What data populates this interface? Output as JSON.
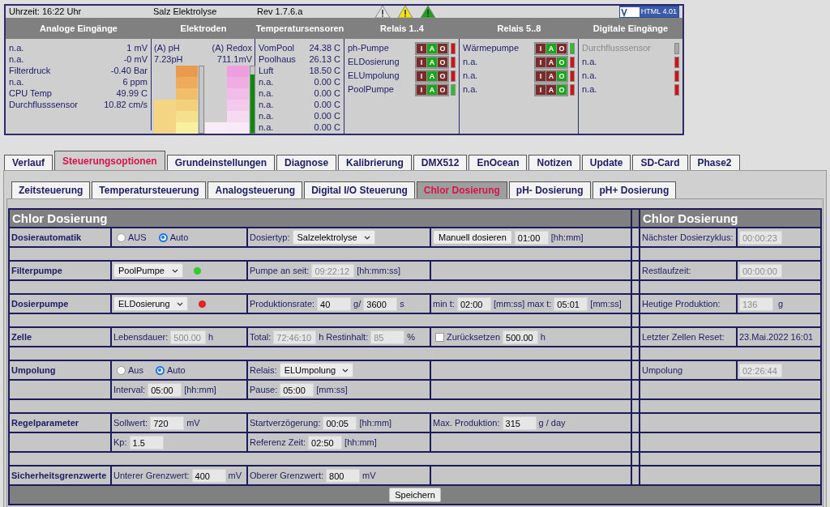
{
  "header": {
    "time": "Uhrzeit: 16:22 Uhr",
    "title": "Salz Elektrolyse",
    "revision": "Rev 1.7.6.a",
    "warnings": [
      {
        "color": "#e4e4e4"
      },
      {
        "color": "#f2e600"
      },
      {
        "color": "#1fa01f"
      }
    ],
    "badge": "HTML 4.01"
  },
  "status_columns": [
    "Analoge Eingänge",
    "Elektroden",
    "Temperatursensoren",
    "Relais 1..4",
    "Relais 5..8",
    "Digitale Eingänge"
  ],
  "analog_inputs": [
    {
      "name": "n.a.",
      "value": "1 mV"
    },
    {
      "name": "n.a.",
      "value": "-0 mV"
    },
    {
      "name": "Filterdruck",
      "value": "-0.40 Bar"
    },
    {
      "name": "n.a.",
      "value": "6 ppm"
    },
    {
      "name": "CPU Temp",
      "value": "49.99 C"
    },
    {
      "name": "Durchflusssensor",
      "value": "10.82 cm/s"
    }
  ],
  "electrodes": [
    {
      "name": "(A) pH",
      "value": "7.23pH"
    },
    {
      "name": "(A) Redox",
      "value": "711.1mV",
      "level": 0.88
    }
  ],
  "temperatures": [
    {
      "name": "VomPool",
      "value": "24.38 C"
    },
    {
      "name": "Poolhaus",
      "value": "26.13 C"
    },
    {
      "name": "Luft",
      "value": "18.50 C"
    },
    {
      "name": "n.a.",
      "value": "0.00 C"
    },
    {
      "name": "n.a.",
      "value": "0.00 C"
    },
    {
      "name": "n.a.",
      "value": "0.00 C"
    },
    {
      "name": "n.a.",
      "value": "0.00 C"
    },
    {
      "name": "n.a.",
      "value": "0.00 C"
    }
  ],
  "relays_1_4": [
    {
      "name": "ph-Pumpe",
      "on": false,
      "modes": [
        {
          "label": "I",
          "selected": false
        },
        {
          "label": "A",
          "selected": true
        },
        {
          "label": "O",
          "selected": false
        }
      ]
    },
    {
      "name": "ELDosierung",
      "on": false,
      "modes": [
        {
          "label": "I",
          "selected": false
        },
        {
          "label": "A",
          "selected": true
        },
        {
          "label": "O",
          "selected": false
        }
      ]
    },
    {
      "name": "ELUmpolung",
      "on": false,
      "modes": [
        {
          "label": "I",
          "selected": false
        },
        {
          "label": "A",
          "selected": true
        },
        {
          "label": "O",
          "selected": false
        }
      ]
    },
    {
      "name": "PoolPumpe",
      "on": true,
      "modes": [
        {
          "label": "I",
          "selected": false
        },
        {
          "label": "A",
          "selected": true
        },
        {
          "label": "O",
          "selected": false
        }
      ]
    }
  ],
  "relays_5_8": [
    {
      "name": "Wärmepumpe",
      "on": true,
      "modes": [
        {
          "label": "I",
          "selected": false
        },
        {
          "label": "A",
          "selected": true
        },
        {
          "label": "O",
          "selected": false
        }
      ]
    },
    {
      "name": "n.a.",
      "on": false,
      "modes": [
        {
          "label": "I",
          "selected": false
        },
        {
          "label": "A",
          "selected": false
        },
        {
          "label": "O",
          "selected": true
        }
      ]
    },
    {
      "name": "n.a.",
      "on": false,
      "modes": [
        {
          "label": "I",
          "selected": false
        },
        {
          "label": "A",
          "selected": false
        },
        {
          "label": "O",
          "selected": true
        }
      ]
    },
    {
      "name": "n.a.",
      "on": false,
      "modes": [
        {
          "label": "I",
          "selected": false
        },
        {
          "label": "A",
          "selected": false
        },
        {
          "label": "O",
          "selected": true
        }
      ]
    }
  ],
  "digital_inputs": [
    {
      "name": "Durchflusssensor",
      "disabled": true
    },
    {
      "name": "n.a.",
      "disabled": false,
      "on": false
    },
    {
      "name": "n.a.",
      "disabled": false,
      "on": false
    },
    {
      "name": "n.a.",
      "disabled": false,
      "on": false
    }
  ],
  "tabs": [
    {
      "label": "Verlauf",
      "selected": false
    },
    {
      "label": "Steuerungsoptionen",
      "selected": true
    },
    {
      "label": "Grundeinstellungen",
      "selected": false
    },
    {
      "label": "Diagnose",
      "selected": false
    },
    {
      "label": "Kalibrierung",
      "selected": false
    },
    {
      "label": "DMX512",
      "selected": false
    },
    {
      "label": "EnOcean",
      "selected": false
    },
    {
      "label": "Notizen",
      "selected": false
    },
    {
      "label": "Update",
      "selected": false
    },
    {
      "label": "SD-Card",
      "selected": false
    },
    {
      "label": "Phase2",
      "selected": false
    }
  ],
  "subtabs": [
    {
      "label": "Zeitsteuerung",
      "selected": false
    },
    {
      "label": "Temperatursteuerung",
      "selected": false
    },
    {
      "label": "Analogsteuerung",
      "selected": false
    },
    {
      "label": "Digital I/O Steuerung",
      "selected": false
    },
    {
      "label": "Chlor Dosierung",
      "selected": true
    },
    {
      "label": "pH- Dosierung",
      "selected": false
    },
    {
      "label": "pH+ Dosierung",
      "selected": false
    }
  ],
  "form": {
    "title": "Chlor Dosierung",
    "side_title": "Chlor Dosierung",
    "save_button": "Speichern",
    "rows": [
      {
        "kind": "row",
        "label": "Dosierautomatik",
        "cells": [
          [
            {
              "kind": "radio",
              "label": "AUS",
              "selected": false
            },
            {
              "kind": "radio",
              "label": "Auto",
              "selected": true
            }
          ],
          [
            {
              "kind": "text",
              "text": "Dosiertyp:"
            },
            {
              "kind": "select",
              "value": "Salzelektrolyse"
            }
          ],
          [
            {
              "kind": "button",
              "label": "Manuell dosieren"
            },
            {
              "kind": "input",
              "value": "01:00",
              "disabled": false
            },
            {
              "kind": "text",
              "text": "[hh:mm]"
            }
          ]
        ],
        "side": {
          "label": "Nächster Dosierzyklus:",
          "items": [
            {
              "kind": "input",
              "value": "00:00:23",
              "disabled": true
            }
          ]
        }
      },
      {
        "kind": "spacer"
      },
      {
        "kind": "row",
        "label": "Filterpumpe",
        "cells": [
          [
            {
              "kind": "select",
              "value": "PoolPumpe"
            },
            {
              "kind": "dot",
              "color": "#2ecc2e"
            }
          ],
          [
            {
              "kind": "text",
              "text": "Pumpe an seit:"
            },
            {
              "kind": "input",
              "value": "09:22:12",
              "disabled": true
            },
            {
              "kind": "text",
              "text": "[hh:mm:ss]"
            }
          ],
          []
        ],
        "side": {
          "label": "Restlaufzeit:",
          "items": [
            {
              "kind": "input",
              "value": "00:00:00",
              "disabled": true
            }
          ]
        }
      },
      {
        "kind": "spacer"
      },
      {
        "kind": "row",
        "label": "Dosierpumpe",
        "cells": [
          [
            {
              "kind": "select",
              "value": "ELDosierung"
            },
            {
              "kind": "dot",
              "color": "#e02424"
            }
          ],
          [
            {
              "kind": "text",
              "text": "Produktionsrate:"
            },
            {
              "kind": "input",
              "value": "40",
              "disabled": false
            },
            {
              "kind": "text",
              "text": "g/"
            },
            {
              "kind": "input",
              "value": "3600",
              "disabled": false
            },
            {
              "kind": "text",
              "text": "s"
            }
          ],
          [
            {
              "kind": "text",
              "text": "min t:"
            },
            {
              "kind": "input",
              "value": "02:00",
              "disabled": false
            },
            {
              "kind": "text",
              "text": "[mm:ss]"
            },
            {
              "kind": "text",
              "text": "max t:"
            },
            {
              "kind": "input",
              "value": "05:01",
              "disabled": false
            },
            {
              "kind": "text",
              "text": "[mm:ss]"
            }
          ]
        ],
        "side": {
          "label": "Heutige Produktion:",
          "items": [
            {
              "kind": "input",
              "value": "136",
              "disabled": true
            },
            {
              "kind": "text",
              "text": "g"
            }
          ]
        }
      },
      {
        "kind": "spacer"
      },
      {
        "kind": "row",
        "label": "Zelle",
        "cells": [
          [
            {
              "kind": "text",
              "text": "Lebensdauer:"
            },
            {
              "kind": "input",
              "value": "500.00",
              "disabled": true
            },
            {
              "kind": "text",
              "text": "h"
            }
          ],
          [
            {
              "kind": "text",
              "text": "Total:"
            },
            {
              "kind": "input",
              "value": "72:46:10",
              "disabled": true
            },
            {
              "kind": "text",
              "text": "h"
            },
            {
              "kind": "text",
              "text": "Restinhalt:"
            },
            {
              "kind": "input",
              "value": "85",
              "disabled": true
            },
            {
              "kind": "text",
              "text": "%"
            }
          ],
          [
            {
              "kind": "checkbox",
              "label": "Zurücksetzen",
              "checked": false
            },
            {
              "kind": "input",
              "value": "500.00",
              "disabled": false
            },
            {
              "kind": "text",
              "text": "h"
            }
          ]
        ],
        "side": {
          "label": "Letzter Zellen Reset:",
          "items": [
            {
              "kind": "text",
              "text": "23.Mai.2022 16:01"
            }
          ]
        }
      },
      {
        "kind": "spacer"
      },
      {
        "kind": "row",
        "label": "Umpolung",
        "cells": [
          [
            {
              "kind": "radio",
              "label": "Aus",
              "selected": false
            },
            {
              "kind": "radio",
              "label": "Auto",
              "selected": true
            }
          ],
          [
            {
              "kind": "text",
              "text": "Relais:"
            },
            {
              "kind": "select",
              "value": "ELUmpolung"
            }
          ],
          []
        ],
        "side": {
          "label": "Umpolung",
          "items": [
            {
              "kind": "input",
              "value": "02:26:44",
              "disabled": true
            }
          ]
        }
      },
      {
        "kind": "row",
        "cells": [
          [
            {
              "kind": "text",
              "text": "Interval:"
            },
            {
              "kind": "input",
              "value": "05:00",
              "disabled": false
            },
            {
              "kind": "text",
              "text": "[hh:mm]"
            }
          ],
          [
            {
              "kind": "text",
              "text": "Pause:"
            },
            {
              "kind": "input",
              "value": "05:00",
              "disabled": false
            },
            {
              "kind": "text",
              "text": "[mm:ss]"
            }
          ],
          []
        ]
      },
      {
        "kind": "spacer"
      },
      {
        "kind": "row",
        "label": "Regelparameter",
        "cells": [
          [
            {
              "kind": "text",
              "text": "Sollwert:"
            },
            {
              "kind": "input",
              "value": "720",
              "disabled": false
            },
            {
              "kind": "text",
              "text": "mV"
            }
          ],
          [
            {
              "kind": "text",
              "text": "Startverzögerung:"
            },
            {
              "kind": "input",
              "value": "00:05",
              "disabled": false
            },
            {
              "kind": "text",
              "text": "[hh:mm]"
            }
          ],
          [
            {
              "kind": "text",
              "text": "Max. Produktion:"
            },
            {
              "kind": "input",
              "value": "315",
              "disabled": false
            },
            {
              "kind": "text",
              "text": "g / day"
            }
          ]
        ]
      },
      {
        "kind": "row",
        "cells": [
          [
            {
              "kind": "text",
              "text": "Kp:"
            },
            {
              "kind": "input",
              "value": "1.5",
              "disabled": false
            }
          ],
          [
            {
              "kind": "text",
              "text": "Referenz Zeit:"
            },
            {
              "kind": "input",
              "value": "02:50",
              "disabled": false
            },
            {
              "kind": "text",
              "text": "[hh:mm]"
            }
          ],
          []
        ]
      },
      {
        "kind": "spacer"
      },
      {
        "kind": "row",
        "label": "Sicherheitsgrenzwerte",
        "cells": [
          [
            {
              "kind": "text",
              "text": "Unterer Grenzwert:"
            },
            {
              "kind": "input",
              "value": "400",
              "disabled": false
            },
            {
              "kind": "text",
              "text": "mV"
            }
          ],
          [
            {
              "kind": "text",
              "text": "Oberer Grenzwert:"
            },
            {
              "kind": "input",
              "value": "800",
              "disabled": false
            },
            {
              "kind": "text",
              "text": "mV"
            }
          ],
          []
        ]
      }
    ]
  }
}
